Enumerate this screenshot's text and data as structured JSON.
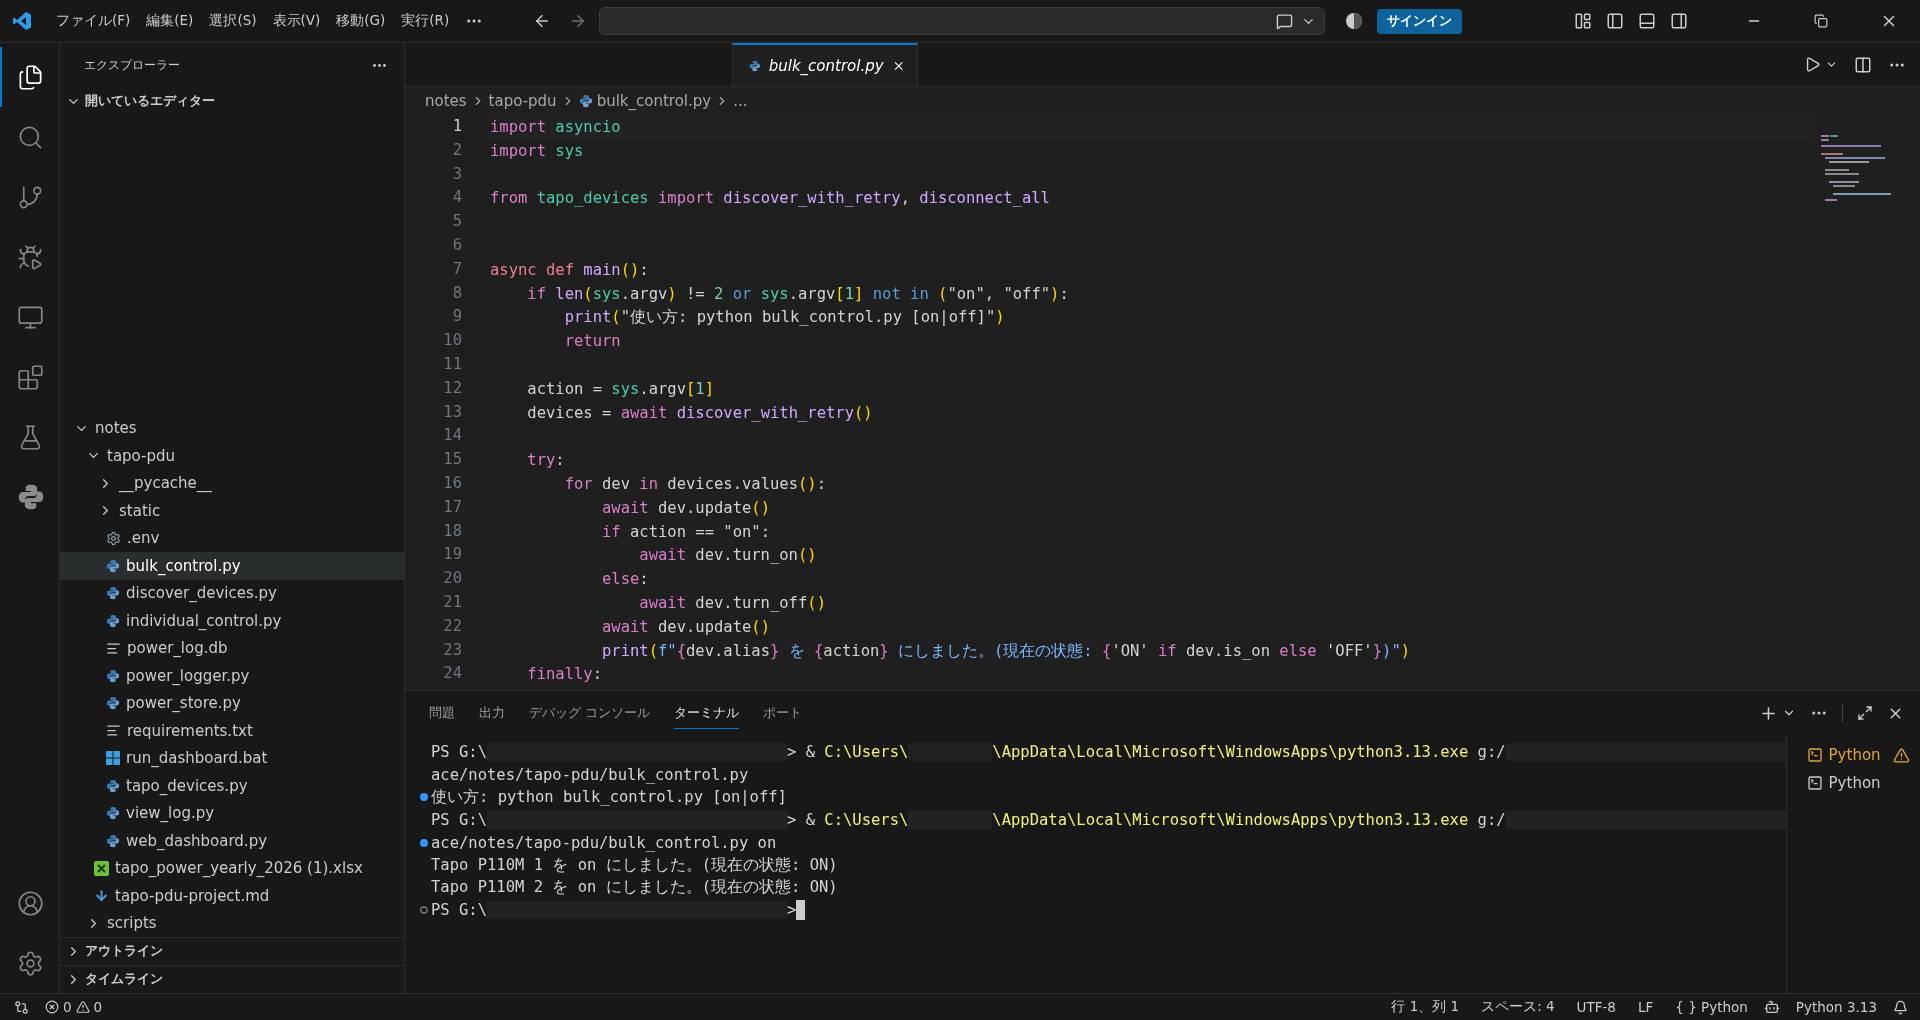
{
  "title_bar": {
    "menu": [
      "ファイル(F)",
      "編集(E)",
      "選択(S)",
      "表示(V)",
      "移動(G)",
      "実行(R)"
    ],
    "sign_in": "サインイン"
  },
  "activity_bar": {
    "top": [
      {
        "kind": "files",
        "selected": true
      },
      {
        "kind": "search",
        "selected": false
      },
      {
        "kind": "source-control",
        "selected": false
      },
      {
        "kind": "run-debug",
        "selected": false
      },
      {
        "kind": "remote",
        "selected": false
      },
      {
        "kind": "extensions",
        "selected": false
      },
      {
        "kind": "testing",
        "selected": false
      },
      {
        "kind": "python",
        "selected": false
      }
    ],
    "bottom": [
      {
        "kind": "account"
      },
      {
        "kind": "settings"
      }
    ]
  },
  "sidebar": {
    "title": "エクスプローラー",
    "open_editors": {
      "label": "開いているエディター",
      "expanded": true
    },
    "tree": [
      {
        "kind": "folder",
        "label": "notes",
        "expanded": true,
        "selected": false,
        "children": [
          {
            "kind": "folder",
            "label": "tapo-pdu",
            "expanded": true,
            "selected": false,
            "children": [
              {
                "kind": "folder",
                "label": "__pycache__",
                "expanded": false,
                "selected": false
              },
              {
                "kind": "folder",
                "label": "static",
                "expanded": false,
                "selected": false
              },
              {
                "kind": "config-file",
                "label": ".env",
                "selected": false
              },
              {
                "kind": "python-file",
                "label": "bulk_control.py",
                "selected": true
              },
              {
                "kind": "python-file",
                "label": "discover_devices.py",
                "selected": false
              },
              {
                "kind": "python-file",
                "label": "individual_control.py",
                "selected": false
              },
              {
                "kind": "text-file",
                "label": "power_log.db",
                "selected": false
              },
              {
                "kind": "python-file",
                "label": "power_logger.py",
                "selected": false
              },
              {
                "kind": "python-file",
                "label": "power_store.py",
                "selected": false
              },
              {
                "kind": "text-file",
                "label": "requirements.txt",
                "selected": false
              },
              {
                "kind": "batch-file",
                "label": "run_dashboard.bat",
                "selected": false
              },
              {
                "kind": "python-file",
                "label": "tapo_devices.py",
                "selected": false
              },
              {
                "kind": "python-file",
                "label": "view_log.py",
                "selected": false
              },
              {
                "kind": "python-file",
                "label": "web_dashboard.py",
                "selected": false
              }
            ]
          },
          {
            "kind": "spreadsheet-file",
            "label": "tapo_power_yearly_2026 (1).xlsx",
            "selected": false
          },
          {
            "kind": "markdown-file",
            "label": "tapo-pdu-project.md",
            "selected": false
          },
          {
            "kind": "folder",
            "label": "scripts",
            "expanded": false,
            "selected": false
          }
        ]
      }
    ],
    "sections": [
      {
        "label": "アウトライン",
        "expanded": false
      },
      {
        "label": "タイムライン",
        "expanded": false
      }
    ]
  },
  "editor": {
    "tab": {
      "label": "bulk_control.py",
      "preview": true
    },
    "breadcrumb": [
      {
        "kind": "folder",
        "label": "notes"
      },
      {
        "kind": "folder",
        "label": "tapo-pdu"
      },
      {
        "kind": "python-file",
        "label": "bulk_control.py"
      },
      {
        "kind": "more",
        "label": "..."
      }
    ],
    "lines": [
      {
        "number": "1",
        "selected": true,
        "tokens": [
          {
            "kind": "kw",
            "t": "import"
          },
          {
            "kind": "mod",
            "t": " asyncio"
          }
        ]
      },
      {
        "number": "2",
        "selected": false,
        "tokens": [
          {
            "kind": "kw",
            "t": "import"
          },
          {
            "kind": "mod",
            "t": " sys"
          }
        ]
      },
      {
        "number": "3",
        "selected": false
      },
      {
        "number": "4",
        "selected": false,
        "tokens": [
          {
            "kind": "kw",
            "t": "from"
          },
          {
            "kind": "mod",
            "t": " tapo_devices"
          },
          {
            "kind": "kw",
            "t": " import"
          },
          {
            "kind": "fn",
            "t": " discover_with_retry"
          },
          {
            "kind": "txt",
            "t": ", "
          },
          {
            "kind": "fn",
            "t": "disconnect_all"
          }
        ]
      },
      {
        "number": "5",
        "selected": false
      },
      {
        "number": "6",
        "selected": false
      },
      {
        "number": "7",
        "selected": false,
        "tokens": [
          {
            "kind": "decl",
            "t": "async def"
          },
          {
            "kind": "fn",
            "t": " main"
          },
          {
            "kind": "br",
            "t": "()"
          },
          {
            "kind": "txt",
            "t": ":"
          }
        ]
      },
      {
        "number": "8",
        "selected": false,
        "tokens": [
          {
            "kind": "kw",
            "t": "    if"
          },
          {
            "kind": "fn",
            "t": " len"
          },
          {
            "kind": "br",
            "t": "("
          },
          {
            "kind": "mod",
            "t": "sys"
          },
          {
            "kind": "txt",
            "t": ".argv"
          },
          {
            "kind": "br",
            "t": ")"
          },
          {
            "kind": "txt",
            "t": " != "
          },
          {
            "kind": "num",
            "t": "2"
          },
          {
            "kind": "op",
            "t": " or"
          },
          {
            "kind": "mod",
            "t": " sys"
          },
          {
            "kind": "txt",
            "t": ".argv"
          },
          {
            "kind": "br",
            "t": "["
          },
          {
            "kind": "num",
            "t": "1"
          },
          {
            "kind": "br",
            "t": "]"
          },
          {
            "kind": "op",
            "t": " not in"
          },
          {
            "kind": "br",
            "t": " ("
          },
          {
            "kind": "txt",
            "t": "\"on\", \"off\""
          },
          {
            "kind": "br",
            "t": ")"
          },
          {
            "kind": "txt",
            "t": ":"
          }
        ]
      },
      {
        "number": "9",
        "selected": false,
        "tokens": [
          {
            "kind": "fn",
            "t": "        print"
          },
          {
            "kind": "br",
            "t": "("
          },
          {
            "kind": "txt",
            "t": "\"使い方: python bulk_control.py [on|off]\""
          },
          {
            "kind": "br",
            "t": ")"
          }
        ]
      },
      {
        "number": "10",
        "selected": false,
        "tokens": [
          {
            "kind": "kw",
            "t": "        return"
          }
        ]
      },
      {
        "number": "11",
        "selected": false
      },
      {
        "number": "12",
        "selected": false,
        "tokens": [
          {
            "kind": "txt",
            "t": "    action = "
          },
          {
            "kind": "mod",
            "t": "sys"
          },
          {
            "kind": "txt",
            "t": ".argv"
          },
          {
            "kind": "br",
            "t": "["
          },
          {
            "kind": "num",
            "t": "1"
          },
          {
            "kind": "br",
            "t": "]"
          }
        ]
      },
      {
        "number": "13",
        "selected": false,
        "tokens": [
          {
            "kind": "txt",
            "t": "    devices = "
          },
          {
            "kind": "kw",
            "t": "await"
          },
          {
            "kind": "fn",
            "t": " discover_with_retry"
          },
          {
            "kind": "br",
            "t": "()"
          }
        ]
      },
      {
        "number": "14",
        "selected": false
      },
      {
        "number": "15",
        "selected": false,
        "tokens": [
          {
            "kind": "kw",
            "t": "    try"
          },
          {
            "kind": "txt",
            "t": ":"
          }
        ]
      },
      {
        "number": "16",
        "selected": false,
        "tokens": [
          {
            "kind": "kw",
            "t": "        for"
          },
          {
            "kind": "txt",
            "t": " dev "
          },
          {
            "kind": "kw",
            "t": "in"
          },
          {
            "kind": "txt",
            "t": " devices.values"
          },
          {
            "kind": "br",
            "t": "()"
          },
          {
            "kind": "txt",
            "t": ":"
          }
        ]
      },
      {
        "number": "17",
        "selected": false,
        "tokens": [
          {
            "kind": "kw",
            "t": "            await"
          },
          {
            "kind": "txt",
            "t": " dev.update"
          },
          {
            "kind": "br",
            "t": "()"
          }
        ]
      },
      {
        "number": "18",
        "selected": false,
        "tokens": [
          {
            "kind": "kw",
            "t": "            if"
          },
          {
            "kind": "txt",
            "t": " action == \"on\":"
          }
        ]
      },
      {
        "number": "19",
        "selected": false,
        "tokens": [
          {
            "kind": "kw",
            "t": "                await"
          },
          {
            "kind": "txt",
            "t": " dev.turn_on"
          },
          {
            "kind": "br",
            "t": "()"
          }
        ]
      },
      {
        "number": "20",
        "selected": false,
        "tokens": [
          {
            "kind": "kw",
            "t": "            else"
          },
          {
            "kind": "txt",
            "t": ":"
          }
        ]
      },
      {
        "number": "21",
        "selected": false,
        "tokens": [
          {
            "kind": "kw",
            "t": "                await"
          },
          {
            "kind": "txt",
            "t": " dev.turn_off"
          },
          {
            "kind": "br",
            "t": "()"
          }
        ]
      },
      {
        "number": "22",
        "selected": false,
        "tokens": [
          {
            "kind": "kw",
            "t": "            await"
          },
          {
            "kind": "txt",
            "t": " dev.update"
          },
          {
            "kind": "br",
            "t": "()"
          }
        ]
      },
      {
        "number": "23",
        "selected": false,
        "tokens": [
          {
            "kind": "fn",
            "t": "            print"
          },
          {
            "kind": "br",
            "t": "("
          },
          {
            "kind": "fstr",
            "t": "f\""
          },
          {
            "kind": "brace",
            "t": "{"
          },
          {
            "kind": "txt",
            "t": "dev.alias"
          },
          {
            "kind": "brace",
            "t": "}"
          },
          {
            "kind": "fstr",
            "t": " を "
          },
          {
            "kind": "brace",
            "t": "{"
          },
          {
            "kind": "txt",
            "t": "action"
          },
          {
            "kind": "brace",
            "t": "}"
          },
          {
            "kind": "fstr",
            "t": " にしました。(現在の状態: "
          },
          {
            "kind": "brace",
            "t": "{"
          },
          {
            "kind": "txt",
            "t": "'ON'"
          },
          {
            "kind": "kw",
            "t": " if "
          },
          {
            "kind": "txt",
            "t": "dev.is_on"
          },
          {
            "kind": "kw",
            "t": " else "
          },
          {
            "kind": "txt",
            "t": "'OFF'"
          },
          {
            "kind": "brace",
            "t": "}"
          },
          {
            "kind": "fstr",
            "t": ")\""
          },
          {
            "kind": "br",
            "t": ")"
          }
        ]
      },
      {
        "number": "24",
        "selected": false,
        "tokens": [
          {
            "kind": "kw",
            "t": "    finally"
          },
          {
            "kind": "txt",
            "t": ":"
          }
        ]
      }
    ]
  },
  "panel": {
    "tabs": [
      {
        "label": "問題",
        "selected": false
      },
      {
        "label": "出力",
        "selected": false
      },
      {
        "label": "デバッグ コンソール",
        "selected": false
      },
      {
        "label": "ターミナル",
        "selected": true
      },
      {
        "label": "ポート",
        "selected": false
      }
    ],
    "terminal": [
      {
        "segments": [
          {
            "kind": "txt",
            "t": "PS G:\\"
          },
          {
            "kind": "mask"
          },
          {
            "kind": "txt",
            "t": "> & "
          },
          {
            "kind": "path",
            "t": "C:\\Users\\"
          },
          {
            "kind": "mask"
          },
          {
            "kind": "path",
            "t": "\\AppData\\Local\\Microsoft\\WindowsApps\\python3.13.exe"
          },
          {
            "kind": "txt",
            "t": " g:/"
          },
          {
            "kind": "mask"
          }
        ]
      },
      {
        "segments": [
          {
            "kind": "txt",
            "t": "ace/notes/tapo-pdu/bulk_control.py"
          }
        ]
      },
      {
        "kind": "success",
        "segments": [
          {
            "kind": "txt",
            "t": "使い方: python bulk_control.py [on|off]"
          }
        ]
      },
      {
        "segments": [
          {
            "kind": "txt",
            "t": "PS G:\\"
          },
          {
            "kind": "mask"
          },
          {
            "kind": "txt",
            "t": "> & "
          },
          {
            "kind": "path",
            "t": "C:\\Users\\"
          },
          {
            "kind": "mask"
          },
          {
            "kind": "path",
            "t": "\\AppData\\Local\\Microsoft\\WindowsApps\\python3.13.exe"
          },
          {
            "kind": "txt",
            "t": " g:/"
          },
          {
            "kind": "mask"
          }
        ]
      },
      {
        "kind": "success",
        "segments": [
          {
            "kind": "txt",
            "t": "ace/notes/tapo-pdu/bulk_control.py on"
          }
        ]
      },
      {
        "segments": [
          {
            "kind": "txt",
            "t": "Tapo P110M 1 を on にしました。(現在の状態: ON)"
          }
        ]
      },
      {
        "segments": [
          {
            "kind": "txt",
            "t": "Tapo P110M 2 を on にしました。(現在の状態: ON)"
          }
        ]
      },
      {
        "kind": "pending",
        "segments": [
          {
            "kind": "txt",
            "t": "PS G:\\"
          },
          {
            "kind": "mask"
          },
          {
            "kind": "txt",
            "t": ">"
          },
          {
            "kind": "cursor"
          }
        ]
      }
    ],
    "sessions": [
      {
        "label": "Python",
        "warning": true
      },
      {
        "label": "Python",
        "warning": false
      }
    ]
  },
  "status_bar": {
    "errors": "0",
    "warnings": "0",
    "items": [
      "行 1、列 1",
      "スペース: 4",
      "UTF-8",
      "LF"
    ],
    "language": {
      "braces": "{ }",
      "label": "Python"
    },
    "interpreter": "Python 3.13"
  }
}
